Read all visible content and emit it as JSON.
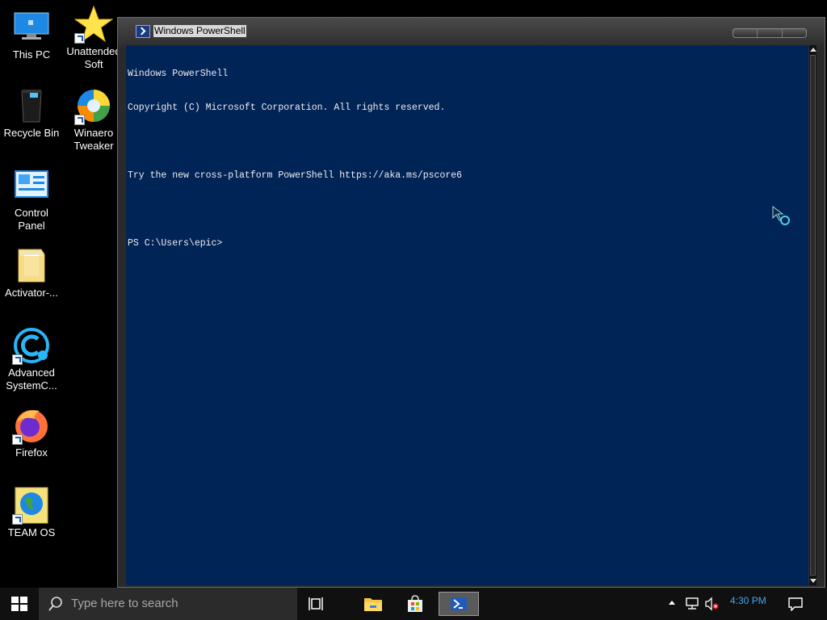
{
  "desktop": {
    "icons": [
      {
        "label": "This PC"
      },
      {
        "label": "Unattended\nSoft"
      },
      {
        "label": "Recycle Bin"
      },
      {
        "label": "Winaero\nTweaker"
      },
      {
        "label": "Control\nPanel"
      },
      {
        "label": "Activator-..."
      },
      {
        "label": "Advanced\nSystemC..."
      },
      {
        "label": "Firefox"
      },
      {
        "label": "TEAM OS"
      }
    ]
  },
  "window": {
    "title": "Windows PowerShell",
    "console_lines": [
      "Windows PowerShell",
      "Copyright (C) Microsoft Corporation. All rights reserved.",
      "",
      "Try the new cross-platform PowerShell https://aka.ms/pscore6",
      "",
      "PS C:\\Users\\epic>"
    ],
    "console_bg": "#012456"
  },
  "taskbar": {
    "search_placeholder": "Type here to search",
    "clock": "4:30 PM",
    "pinned": [
      "task-view-icon",
      "file-explorer-icon",
      "store-icon",
      "powershell-icon"
    ]
  }
}
